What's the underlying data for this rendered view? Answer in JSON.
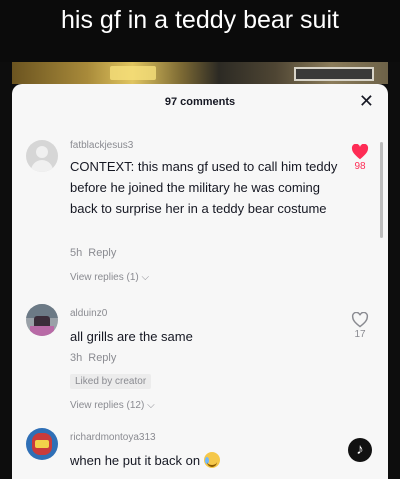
{
  "caption": "his gf in a teddy bear suit",
  "sheet": {
    "title": "97 comments"
  },
  "comments": [
    {
      "username": "fatblackjesus3",
      "text": "CONTEXT: this mans gf used to call him teddy before he joined the military he was coming back to surprise her in a teddy bear costume",
      "time": "5h",
      "reply_label": "Reply",
      "view_replies": "View replies (1)",
      "likes": "98",
      "liked": true
    },
    {
      "username": "alduinz0",
      "text": "all grills are the same",
      "time": "3h",
      "reply_label": "Reply",
      "badge": "Liked by creator",
      "view_replies": "View replies (12)",
      "likes": "17",
      "liked": false
    },
    {
      "username": "richardmontoya313",
      "text": "when he put it back on",
      "emoji": "sweat-smile-emoji"
    }
  ],
  "colors": {
    "liked": "#fe2c55",
    "muted": "#8a8b91",
    "text": "#161823",
    "sheet": "#f7f7f7"
  }
}
